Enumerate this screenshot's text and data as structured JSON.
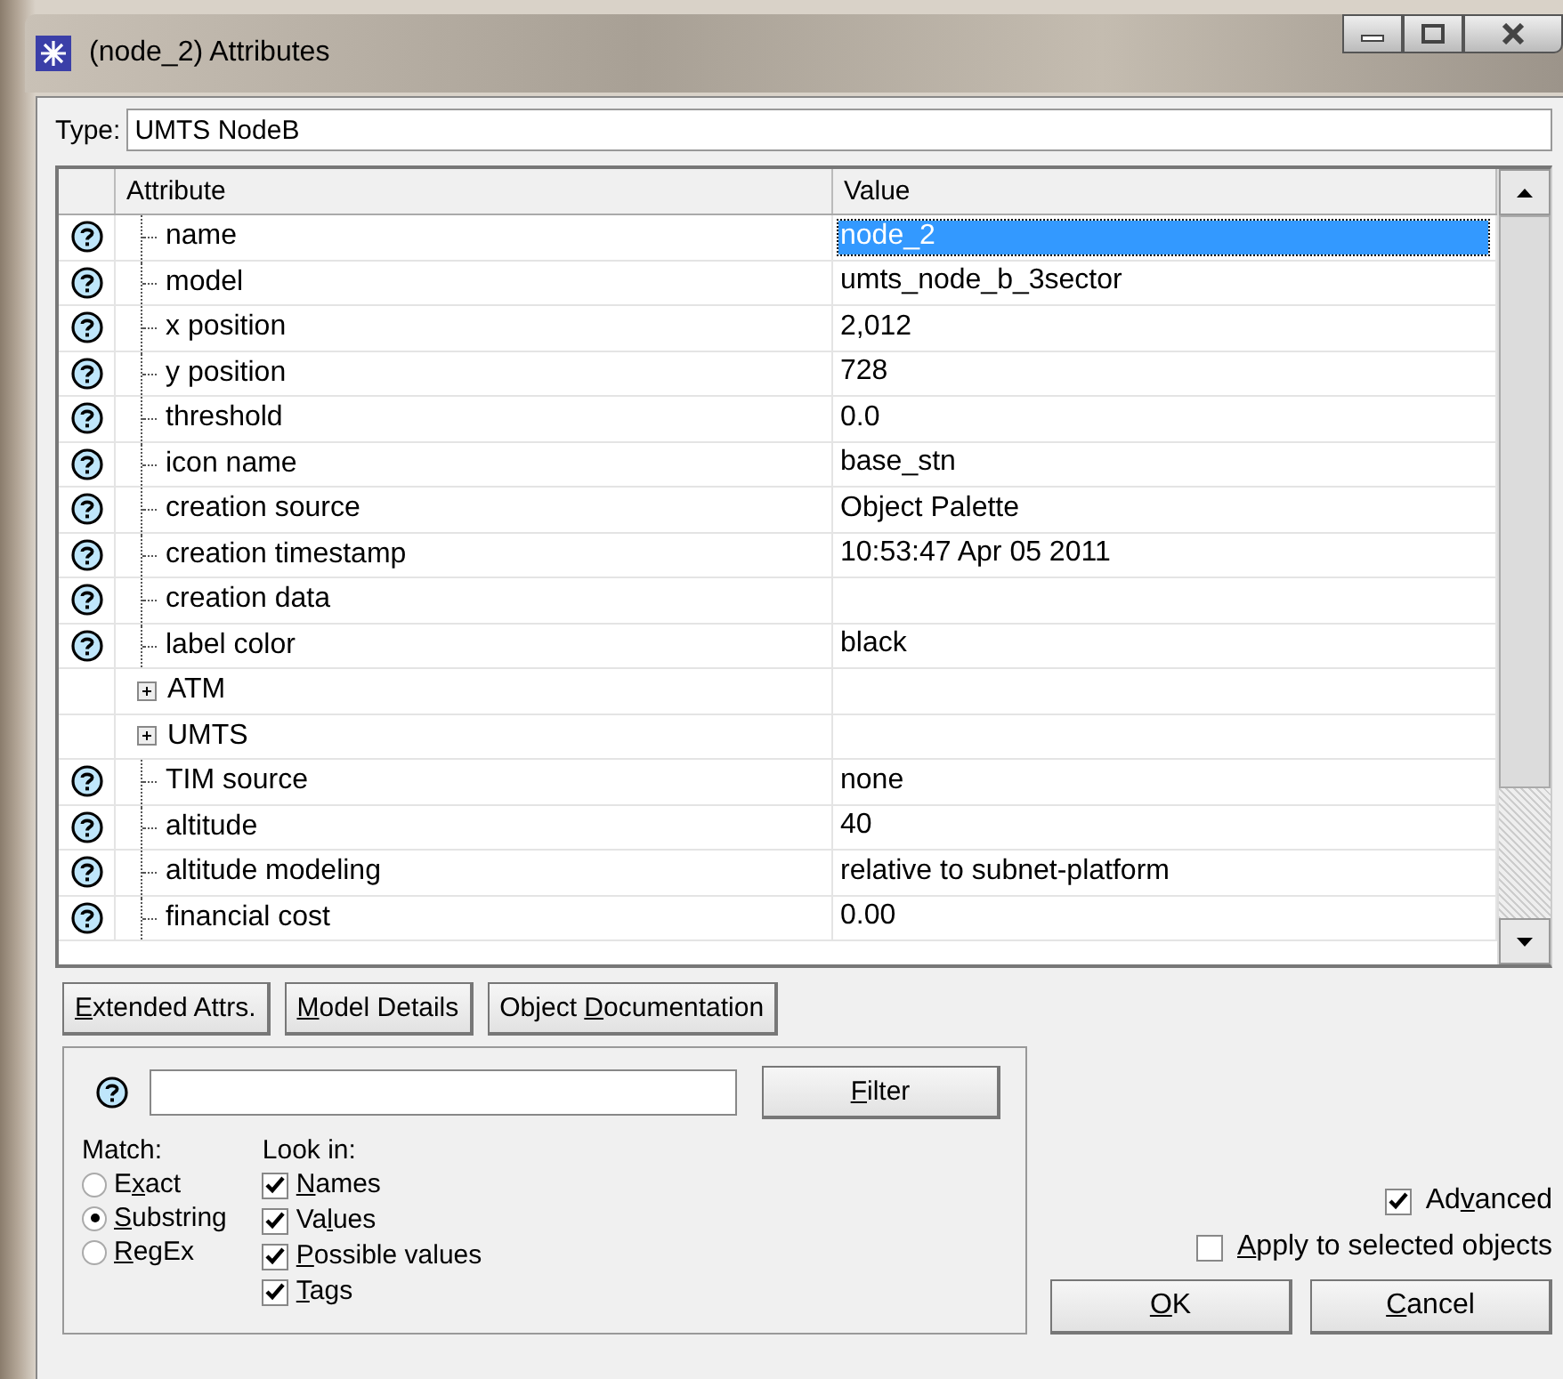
{
  "window": {
    "title": "(node_2) Attributes"
  },
  "type_field": {
    "label": "Type:",
    "value": "UMTS NodeB"
  },
  "table": {
    "columns": [
      "Attribute",
      "Value"
    ],
    "rows": [
      {
        "kind": "attr",
        "name": "name",
        "value": "node_2",
        "selected": true
      },
      {
        "kind": "attr",
        "name": "model",
        "value": "umts_node_b_3sector",
        "selected": false
      },
      {
        "kind": "attr",
        "name": "x position",
        "value": "2,012",
        "selected": false
      },
      {
        "kind": "attr",
        "name": "y position",
        "value": "728",
        "selected": false
      },
      {
        "kind": "attr",
        "name": "threshold",
        "value": "0.0",
        "selected": false
      },
      {
        "kind": "attr",
        "name": "icon name",
        "value": "base_stn",
        "selected": false
      },
      {
        "kind": "attr",
        "name": "creation source",
        "value": "Object Palette",
        "selected": false
      },
      {
        "kind": "attr",
        "name": "creation timestamp",
        "value": "10:53:47 Apr 05 2011",
        "selected": false
      },
      {
        "kind": "attr",
        "name": "creation data",
        "selected": false
      },
      {
        "kind": "attr",
        "name": "label color",
        "value": "black",
        "selected": false
      },
      {
        "kind": "group",
        "name": "ATM",
        "expanded": false,
        "selected": false
      },
      {
        "kind": "group",
        "name": "UMTS",
        "expanded": false,
        "selected": false
      },
      {
        "kind": "attr",
        "name": "TIM source",
        "value": "none",
        "selected": false
      },
      {
        "kind": "attr",
        "name": "altitude",
        "value": "40",
        "selected": false
      },
      {
        "kind": "attr",
        "name": "altitude modeling",
        "value": "relative to subnet-platform",
        "selected": false
      },
      {
        "kind": "attr",
        "name": "financial cost",
        "value": "0.00",
        "selected": false
      }
    ]
  },
  "detail_buttons": [
    {
      "key": "E",
      "after": "xtended Attrs."
    },
    {
      "key": "M",
      "after": "odel Details"
    },
    {
      "before": "Object ",
      "key": "D",
      "after": "ocumentation"
    }
  ],
  "filter": {
    "button": {
      "key": "F",
      "after": "ilter"
    },
    "match_label": "Match:",
    "match_options": [
      {
        "label": {
          "before": "E",
          "key": "x",
          "after": "act"
        },
        "selected": false
      },
      {
        "label": {
          "key": "S",
          "after": "ubstring"
        },
        "selected": true
      },
      {
        "label": {
          "key": "R",
          "after": "egEx"
        },
        "selected": false
      }
    ],
    "look_in_label": "Look in:",
    "look_in_options": [
      {
        "label": {
          "key": "N",
          "after": "ames"
        },
        "checked": true
      },
      {
        "label": {
          "before": "Va",
          "key": "l",
          "after": "ues"
        },
        "checked": true
      },
      {
        "label": {
          "key": "P",
          "after": "ossible values"
        },
        "checked": true
      },
      {
        "label": {
          "key": "T",
          "after": "ags"
        },
        "checked": true
      }
    ]
  },
  "advanced": {
    "label": {
      "before": "Ad",
      "key": "v",
      "after": "anced"
    },
    "checked": true
  },
  "apply_selected": {
    "label": {
      "key": "A",
      "after": "pply to selected objects"
    },
    "checked": false
  },
  "buttons": [
    {
      "key": "O",
      "after": "K"
    },
    {
      "key": "C",
      "after": "ancel"
    }
  ]
}
